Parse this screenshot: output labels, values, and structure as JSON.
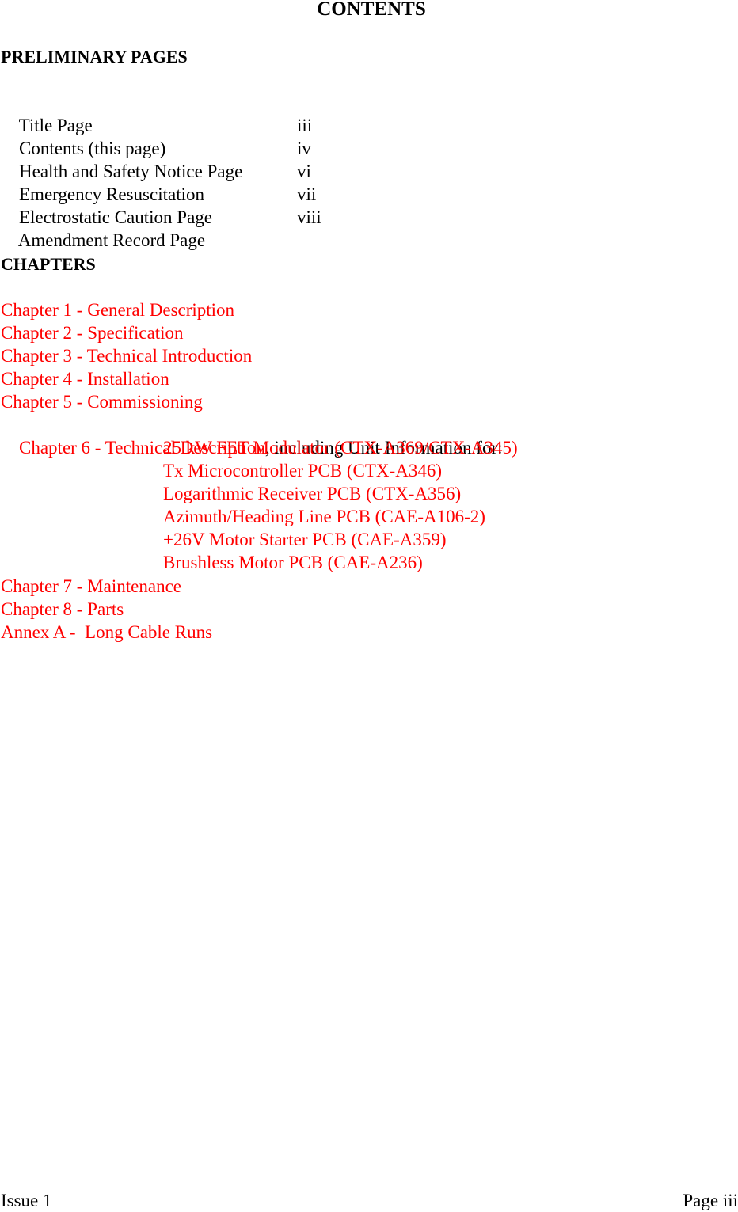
{
  "title": "CONTENTS",
  "preliminary": {
    "heading": "PRELIMINARY PAGES",
    "items": [
      {
        "label": "Title Page",
        "page": ""
      },
      {
        "label": "Contents (this page)",
        "page": "iii"
      },
      {
        "label": "Health and Safety Notice Page",
        "page": "iv"
      },
      {
        "label": "Emergency Resuscitation",
        "page": "vi"
      },
      {
        "label": "Electrostatic Caution Page",
        "page": "vii"
      },
      {
        "label": "Amendment Record Page",
        "page": "viii"
      }
    ]
  },
  "chapters": {
    "heading": "CHAPTERS",
    "items": [
      {
        "label": "Chapter 1 - General Description"
      },
      {
        "label": "Chapter 2 - Specification"
      },
      {
        "label": "Chapter 3 - Technical Introduction"
      },
      {
        "label": "Chapter 4 - Installation"
      },
      {
        "label": "Chapter 5 - Commissioning"
      },
      {
        "label": "Chapter 6 - Technical Description",
        "suffix": ", including Unit Information for:"
      }
    ],
    "units": [
      "25 kW FET Modulator (CTX-A369/CTX-A345)",
      "Tx Microcontroller PCB (CTX-A346)",
      "Logarithmic Receiver PCB (CTX-A356)",
      "Azimuth/Heading Line PCB (CAE-A106-2)",
      "+26V Motor Starter PCB (CAE-A359)",
      "Brushless Motor PCB (CAE-A236)"
    ],
    "after": [
      {
        "label": "Chapter 7 - Maintenance"
      },
      {
        "label": "Chapter 8 - Parts"
      },
      {
        "label": "Annex A -  Long Cable Runs"
      }
    ]
  },
  "footer": {
    "issue": "Issue 1",
    "page": "Page iii"
  },
  "colors": {
    "link": "#ff0000",
    "text": "#000000"
  }
}
